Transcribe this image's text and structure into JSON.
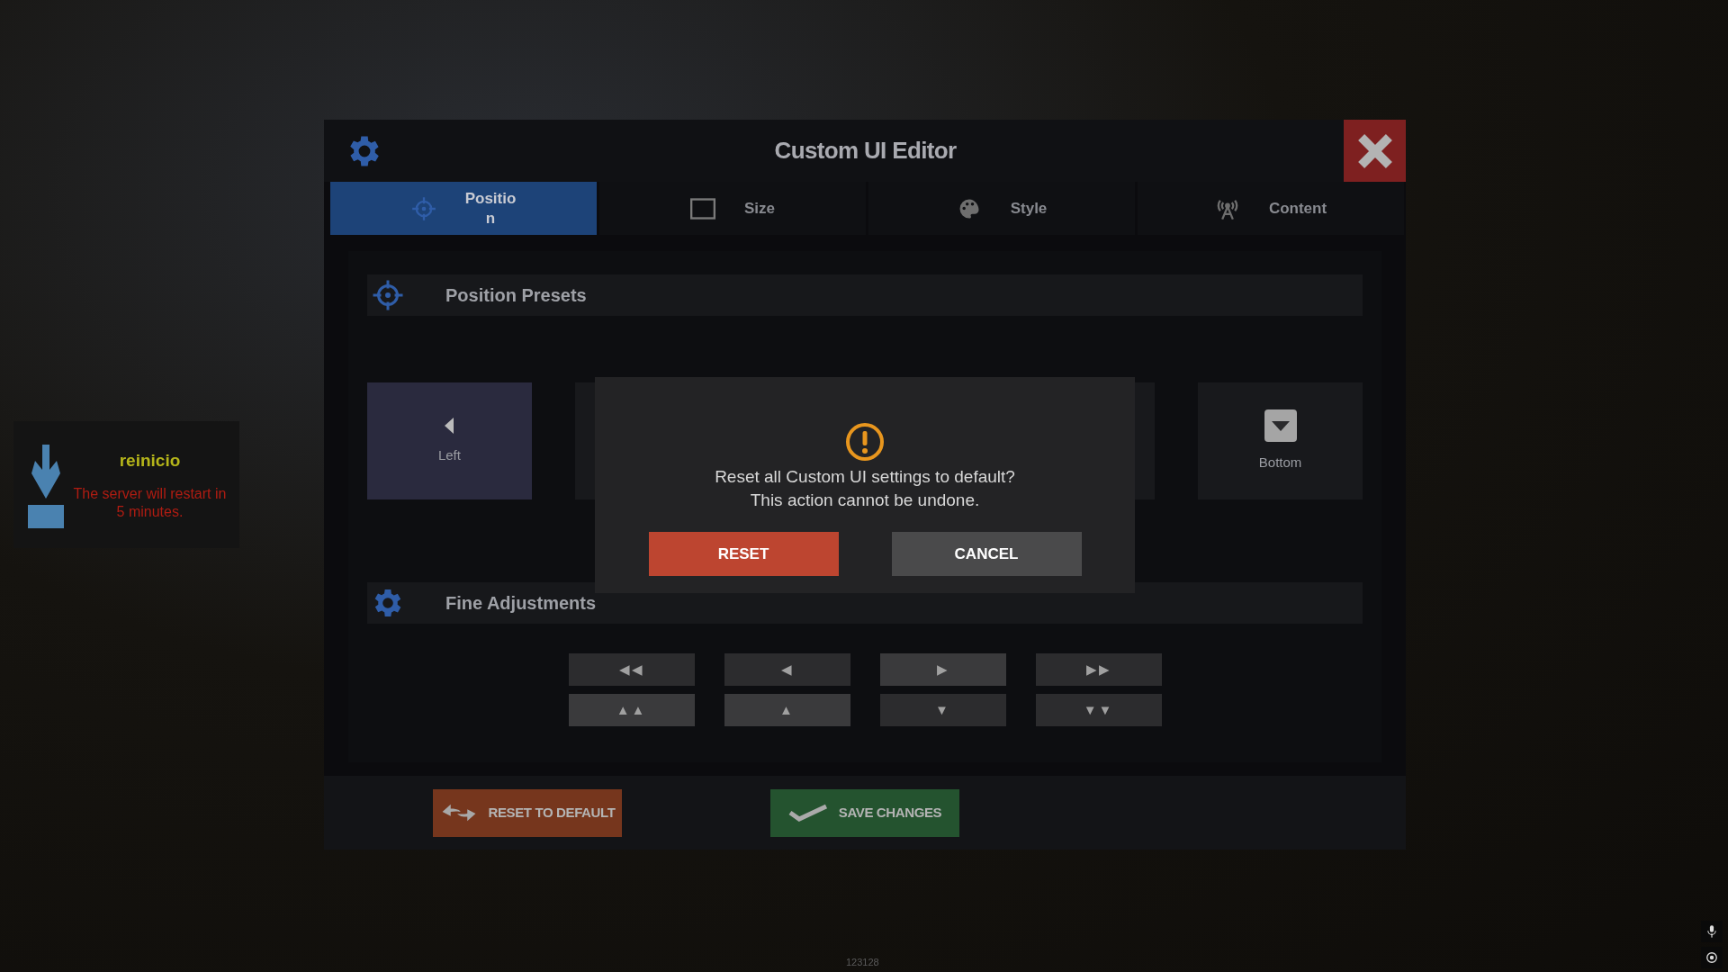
{
  "window": {
    "title": "Custom UI Editor"
  },
  "tabs": [
    {
      "label": "Positio\nn",
      "kind": "crosshair",
      "selected": true
    },
    {
      "label": "Size",
      "kind": "square",
      "selected": false
    },
    {
      "label": "Style",
      "kind": "palette",
      "selected": false
    },
    {
      "label": "Content",
      "kind": "antenna",
      "selected": false
    }
  ],
  "position_presets": {
    "title": "Position Presets",
    "items": [
      {
        "kind": "left",
        "label": "Left",
        "selected": true
      },
      {
        "kind": "covered"
      },
      {
        "kind": "covered"
      },
      {
        "kind": "covered"
      },
      {
        "kind": "bottom",
        "label": "Bottom",
        "selected": false
      }
    ]
  },
  "fine_adjustments": {
    "title": "Fine Adjustments",
    "rows": [
      [
        {
          "glyph": "◀◀",
          "highlighted": false
        },
        {
          "glyph": "◀",
          "highlighted": false
        },
        {
          "glyph": "▶",
          "highlighted": true
        },
        {
          "glyph": "▶▶",
          "highlighted": false
        }
      ],
      [
        {
          "glyph": "▲▲",
          "highlighted": true
        },
        {
          "glyph": "▲",
          "highlighted": true
        },
        {
          "glyph": "▼",
          "highlighted": false
        },
        {
          "glyph": "▼▼",
          "highlighted": false
        }
      ]
    ]
  },
  "footer_buttons": [
    {
      "kind": "reset",
      "label": "RESET TO DEFAULT"
    },
    {
      "kind": "save",
      "label": "SAVE CHANGES"
    }
  ],
  "confirm_dialog": {
    "message": "Reset all Custom UI settings to default?\nThis action cannot be undone.",
    "buttons": [
      {
        "kind": "danger",
        "label": "RESET"
      },
      {
        "kind": "neutral",
        "label": "CANCEL"
      }
    ]
  },
  "notification": {
    "title": "reinicio",
    "message": "The server will restart in 5 minutes."
  },
  "build_number": "123128"
}
